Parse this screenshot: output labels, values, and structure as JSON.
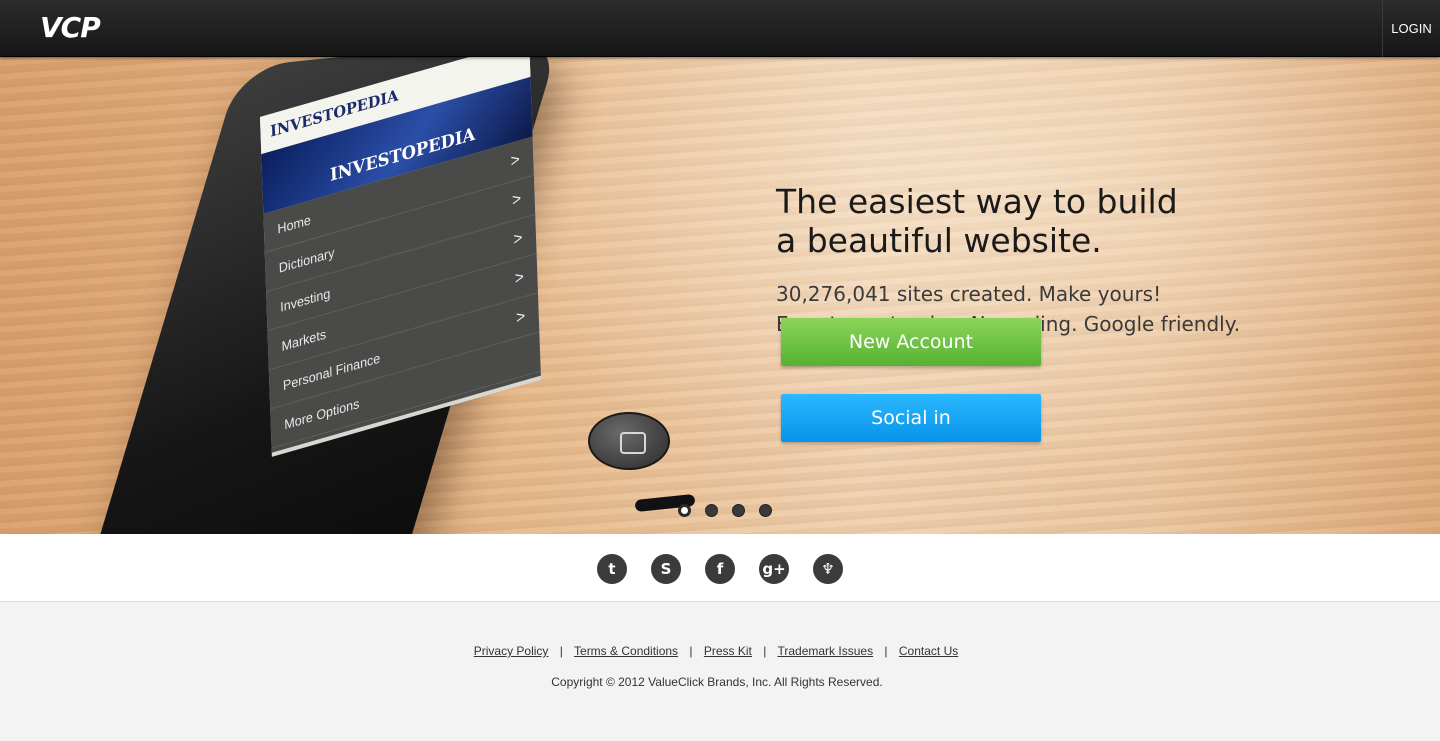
{
  "header": {
    "logo": "VCP",
    "login_label": "LOGIN"
  },
  "hero": {
    "title_line1": "The easiest way to build",
    "title_line2": "a beautiful website.",
    "sub_line1": "30,276,041 sites created. Make yours!",
    "sub_line2": "Easy to customize. No coding. Google friendly.",
    "new_account_label": "New Account",
    "social_in_label": "Social in",
    "carousel": {
      "slide_count": 4,
      "active_index": 0
    },
    "phone": {
      "brand": "INVESTOPEDIA",
      "banner": "INVESTOPEDIA",
      "menu": [
        "Home",
        "Dictionary",
        "Investing",
        "Markets",
        "Personal Finance",
        "More Options"
      ]
    }
  },
  "social": {
    "icons": [
      {
        "name": "twitter-icon",
        "glyph": "t"
      },
      {
        "name": "skype-icon",
        "glyph": "S"
      },
      {
        "name": "facebook-icon",
        "glyph": "f"
      },
      {
        "name": "google-plus-icon",
        "glyph": "g+"
      },
      {
        "name": "github-icon",
        "glyph": "♆"
      }
    ]
  },
  "footer": {
    "links": [
      "Privacy Policy",
      "Terms & Conditions",
      "Press Kit",
      "Trademark Issues",
      "Contact Us"
    ],
    "separator": "|",
    "copyright": "Copyright © 2012 ValueClick Brands, Inc. All Rights Reserved."
  },
  "colors": {
    "topbar": "#1f1f1f",
    "new_account": "#6cc443",
    "social_in": "#1aa6f5",
    "icon_circle": "#3b3b3b"
  }
}
